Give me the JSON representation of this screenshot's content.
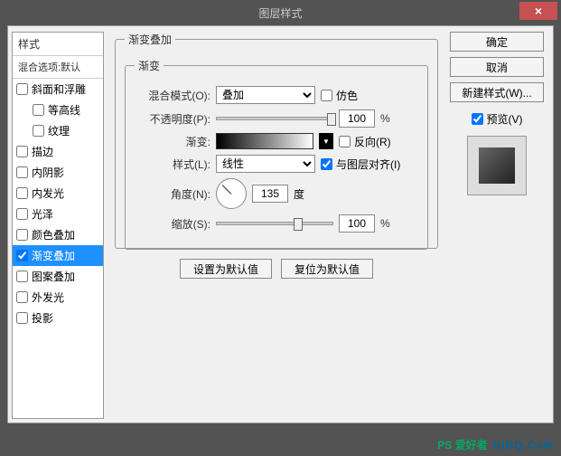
{
  "titlebar": {
    "title": "图层样式",
    "close": "×"
  },
  "left": {
    "header": "样式",
    "subheader": "混合选项:默认",
    "items": [
      {
        "label": "斜面和浮雕",
        "checked": false,
        "indent": false
      },
      {
        "label": "等高线",
        "checked": false,
        "indent": true
      },
      {
        "label": "纹理",
        "checked": false,
        "indent": true
      },
      {
        "label": "描边",
        "checked": false,
        "indent": false
      },
      {
        "label": "内阴影",
        "checked": false,
        "indent": false
      },
      {
        "label": "内发光",
        "checked": false,
        "indent": false
      },
      {
        "label": "光泽",
        "checked": false,
        "indent": false
      },
      {
        "label": "颜色叠加",
        "checked": false,
        "indent": false
      },
      {
        "label": "渐变叠加",
        "checked": true,
        "indent": false,
        "active": true
      },
      {
        "label": "图案叠加",
        "checked": false,
        "indent": false
      },
      {
        "label": "外发光",
        "checked": false,
        "indent": false
      },
      {
        "label": "投影",
        "checked": false,
        "indent": false
      }
    ]
  },
  "center": {
    "group_title": "渐变叠加",
    "inner_title": "渐变",
    "blend_label": "混合模式(O):",
    "blend_value": "叠加",
    "dither_label": "仿色",
    "opacity_label": "不透明度(P):",
    "opacity_value": "100",
    "gradient_label": "渐变:",
    "reverse_label": "反向(R)",
    "style_label": "样式(L):",
    "style_value": "线性",
    "align_label": "与图层对齐(I)",
    "angle_label": "角度(N):",
    "angle_value": "135",
    "angle_unit": "度",
    "scale_label": "缩放(S):",
    "scale_value": "100",
    "pct": "%",
    "set_default": "设置为默认值",
    "reset_default": "复位为默认值"
  },
  "right": {
    "ok": "确定",
    "cancel": "取消",
    "new_style": "新建样式(W)...",
    "preview_label": "预览(V)"
  },
  "watermark": {
    "brand": "PS 爱好者",
    "url": "UiBQ.CoM"
  }
}
